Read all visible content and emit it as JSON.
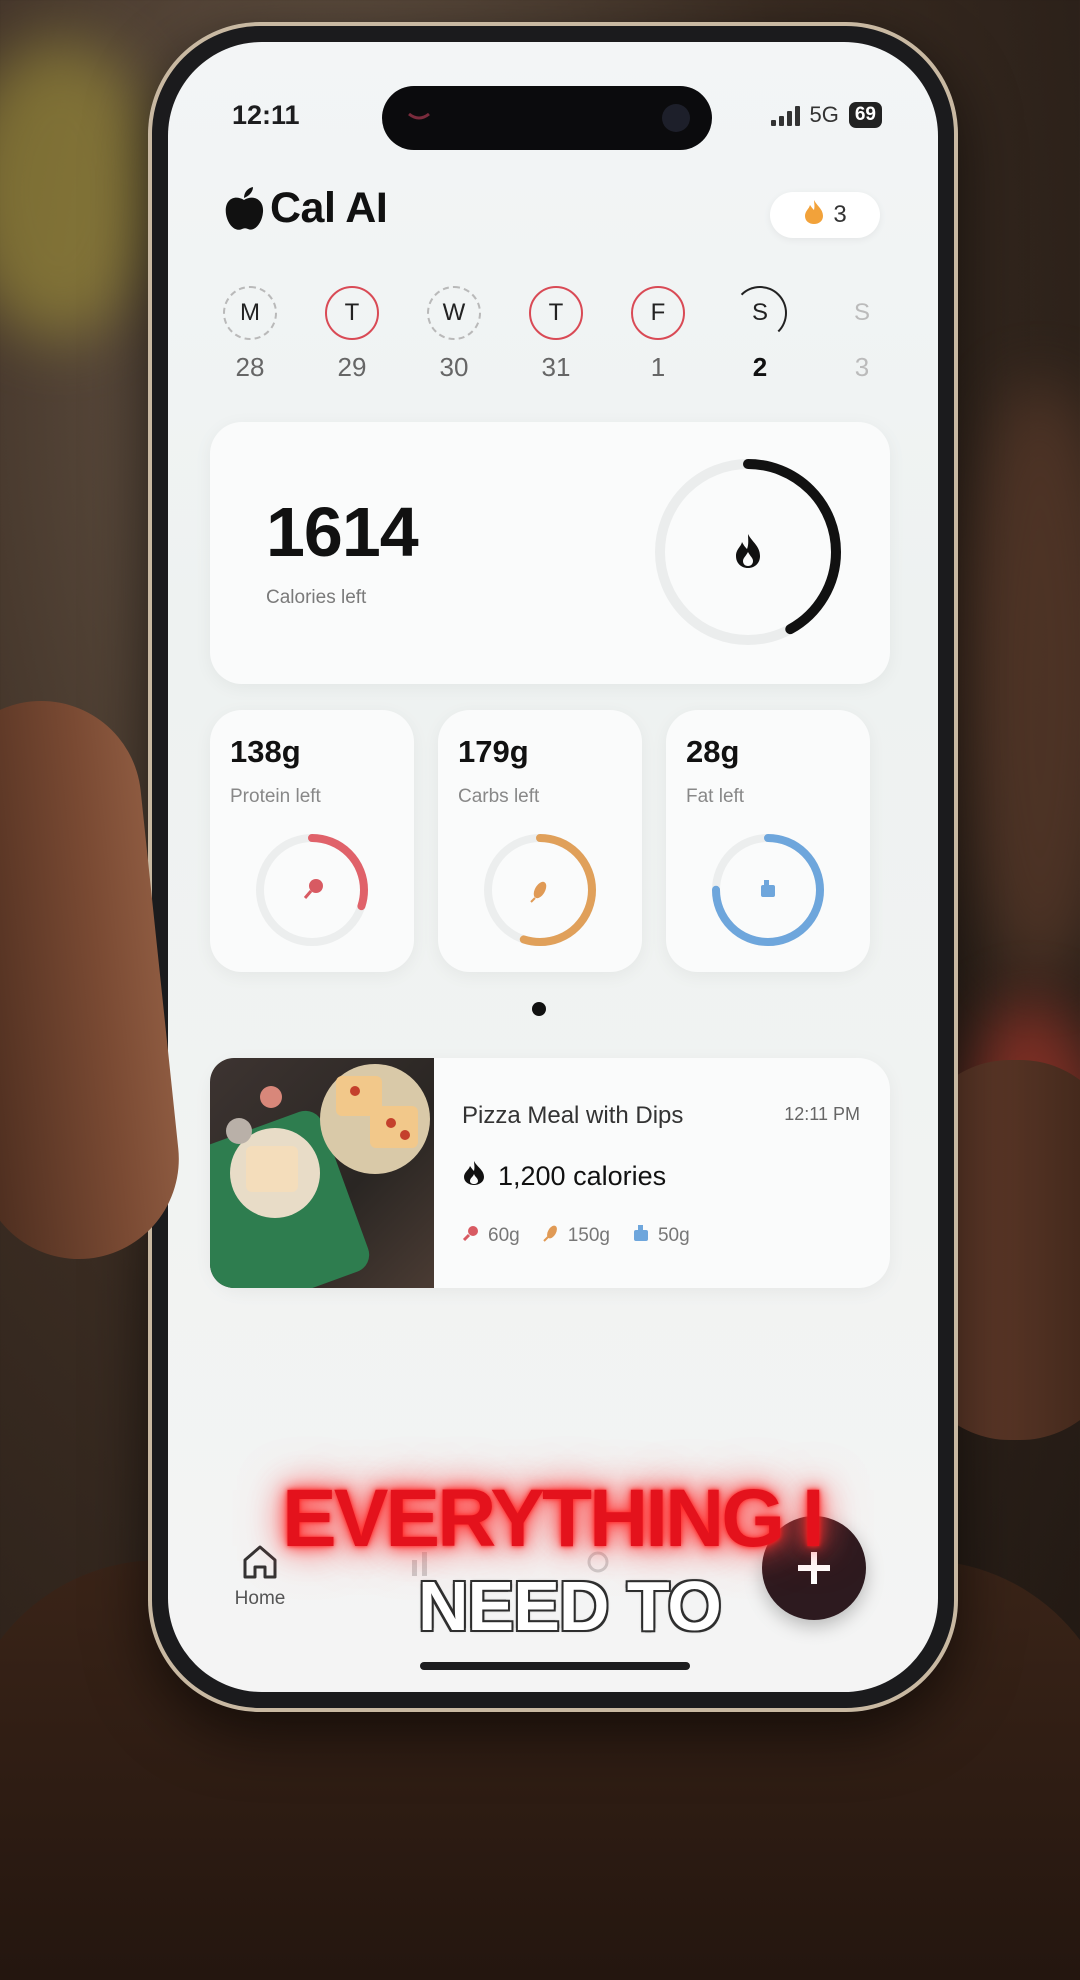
{
  "status": {
    "time": "12:11",
    "network": "5G",
    "battery": "69"
  },
  "header": {
    "app_name": "Cal AI",
    "streak_count": "3"
  },
  "week": [
    {
      "letter": "M",
      "date": "28",
      "style": "dashed"
    },
    {
      "letter": "T",
      "date": "29",
      "style": "red"
    },
    {
      "letter": "W",
      "date": "30",
      "style": "dashed"
    },
    {
      "letter": "T",
      "date": "31",
      "style": "red"
    },
    {
      "letter": "F",
      "date": "1",
      "style": "red"
    },
    {
      "letter": "S",
      "date": "2",
      "style": "selected"
    },
    {
      "letter": "S",
      "date": "3",
      "style": "future"
    }
  ],
  "calories": {
    "value": "1614",
    "label": "Calories left",
    "progress": 0.42
  },
  "macros": [
    {
      "value": "138g",
      "label": "Protein left",
      "color": "#e0626a",
      "progress": 0.3
    },
    {
      "value": "179g",
      "label": "Carbs left",
      "color": "#e0a05a",
      "progress": 0.55
    },
    {
      "value": "28g",
      "label": "Fat left",
      "color": "#6ea6dc",
      "progress": 0.75
    }
  ],
  "meal": {
    "name": "Pizza Meal with Dips",
    "time": "12:11 PM",
    "calories": "1,200 calories",
    "protein": "60g",
    "carbs": "150g",
    "fat": "50g"
  },
  "tabbar": {
    "home_label": "Home"
  },
  "captions": {
    "line1": "EVERYTHING I",
    "line2": "NEED TO"
  },
  "colors": {
    "ring": "#111111",
    "accent_red": "#d94a55",
    "caption_red": "#e4121c"
  }
}
